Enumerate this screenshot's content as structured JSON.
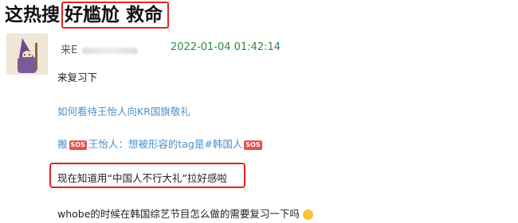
{
  "headline": {
    "prefix": "这热搜",
    "highlight": "好尴尬 救命"
  },
  "comment": {
    "username": "来E",
    "timestamp": "2022-01-04 01:42:14",
    "line1": "来复习下",
    "line2": "如何看待王怡人向KR国旗敬礼",
    "line3": {
      "part1": "搬",
      "badge": "SOS",
      "part2": "王怡人：想被形容的tag是#韩国人",
      "badge2": "SOS"
    },
    "line4": "现在知道用“中国人不行大礼”拉好感啦",
    "line5": "whobe的时候在韩国综艺节目怎么做的需要复习一下吗"
  },
  "colors": {
    "timestamp": "#2b8a4a",
    "link": "#4a90c9",
    "highlight_box": "#e0251b"
  }
}
